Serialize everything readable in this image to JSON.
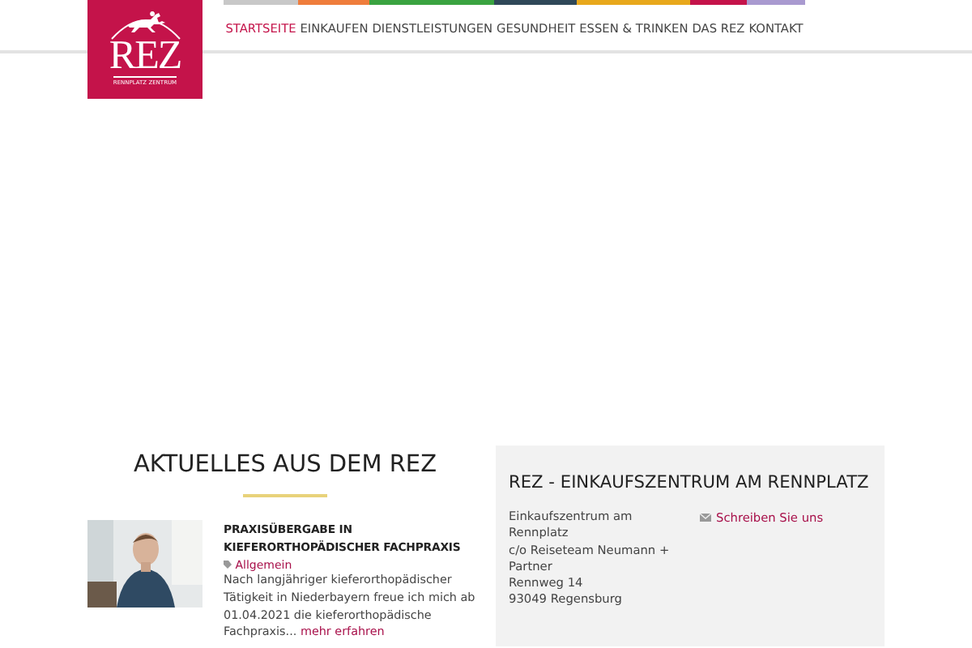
{
  "logo": {
    "name": "REZ",
    "tagline": "RENNPLATZ ZENTRUM"
  },
  "nav": [
    {
      "label": "STARTSEITE",
      "selected": true,
      "color": "#c8c8c8"
    },
    {
      "label": "EINKAUFEN",
      "selected": false,
      "color": "#ef7d3c"
    },
    {
      "label": "DIENSTLEISTUNGEN",
      "selected": false,
      "color": "#3aa340"
    },
    {
      "label": "GESUNDHEIT",
      "selected": false,
      "color": "#2f4858"
    },
    {
      "label": "ESSEN & TRINKEN",
      "selected": false,
      "color": "#e8a81c"
    },
    {
      "label": "DAS REZ",
      "selected": false,
      "color": "#c4134a"
    },
    {
      "label": "KONTAKT",
      "selected": false,
      "color": "#a99ad0"
    }
  ],
  "news": {
    "heading": "AKTUELLES AUS DEM REZ",
    "posts": [
      {
        "kind": "picture",
        "title": "PRAXISÜBERGABE IN KIEFERORTHOPÄDISCHER FACHPRAXIS",
        "category": "Allgemein",
        "excerpt": "Nach langjähriger kieferorthopädischer Tätigkeit in Niederbayern freue ich mich ab 01.04.2021 die kieferorthopädische Fachpraxis...",
        "more": "mehr erfahren"
      }
    ]
  },
  "contact": {
    "heading": "REZ - EINKAUFSZENTRUM AM RENNPLATZ",
    "address": [
      "Einkaufszentrum am Rennplatz",
      "c/o Reiseteam Neumann + Partner",
      "Rennweg 14",
      "93049 Regensburg"
    ],
    "link": "Schreiben Sie uns"
  }
}
